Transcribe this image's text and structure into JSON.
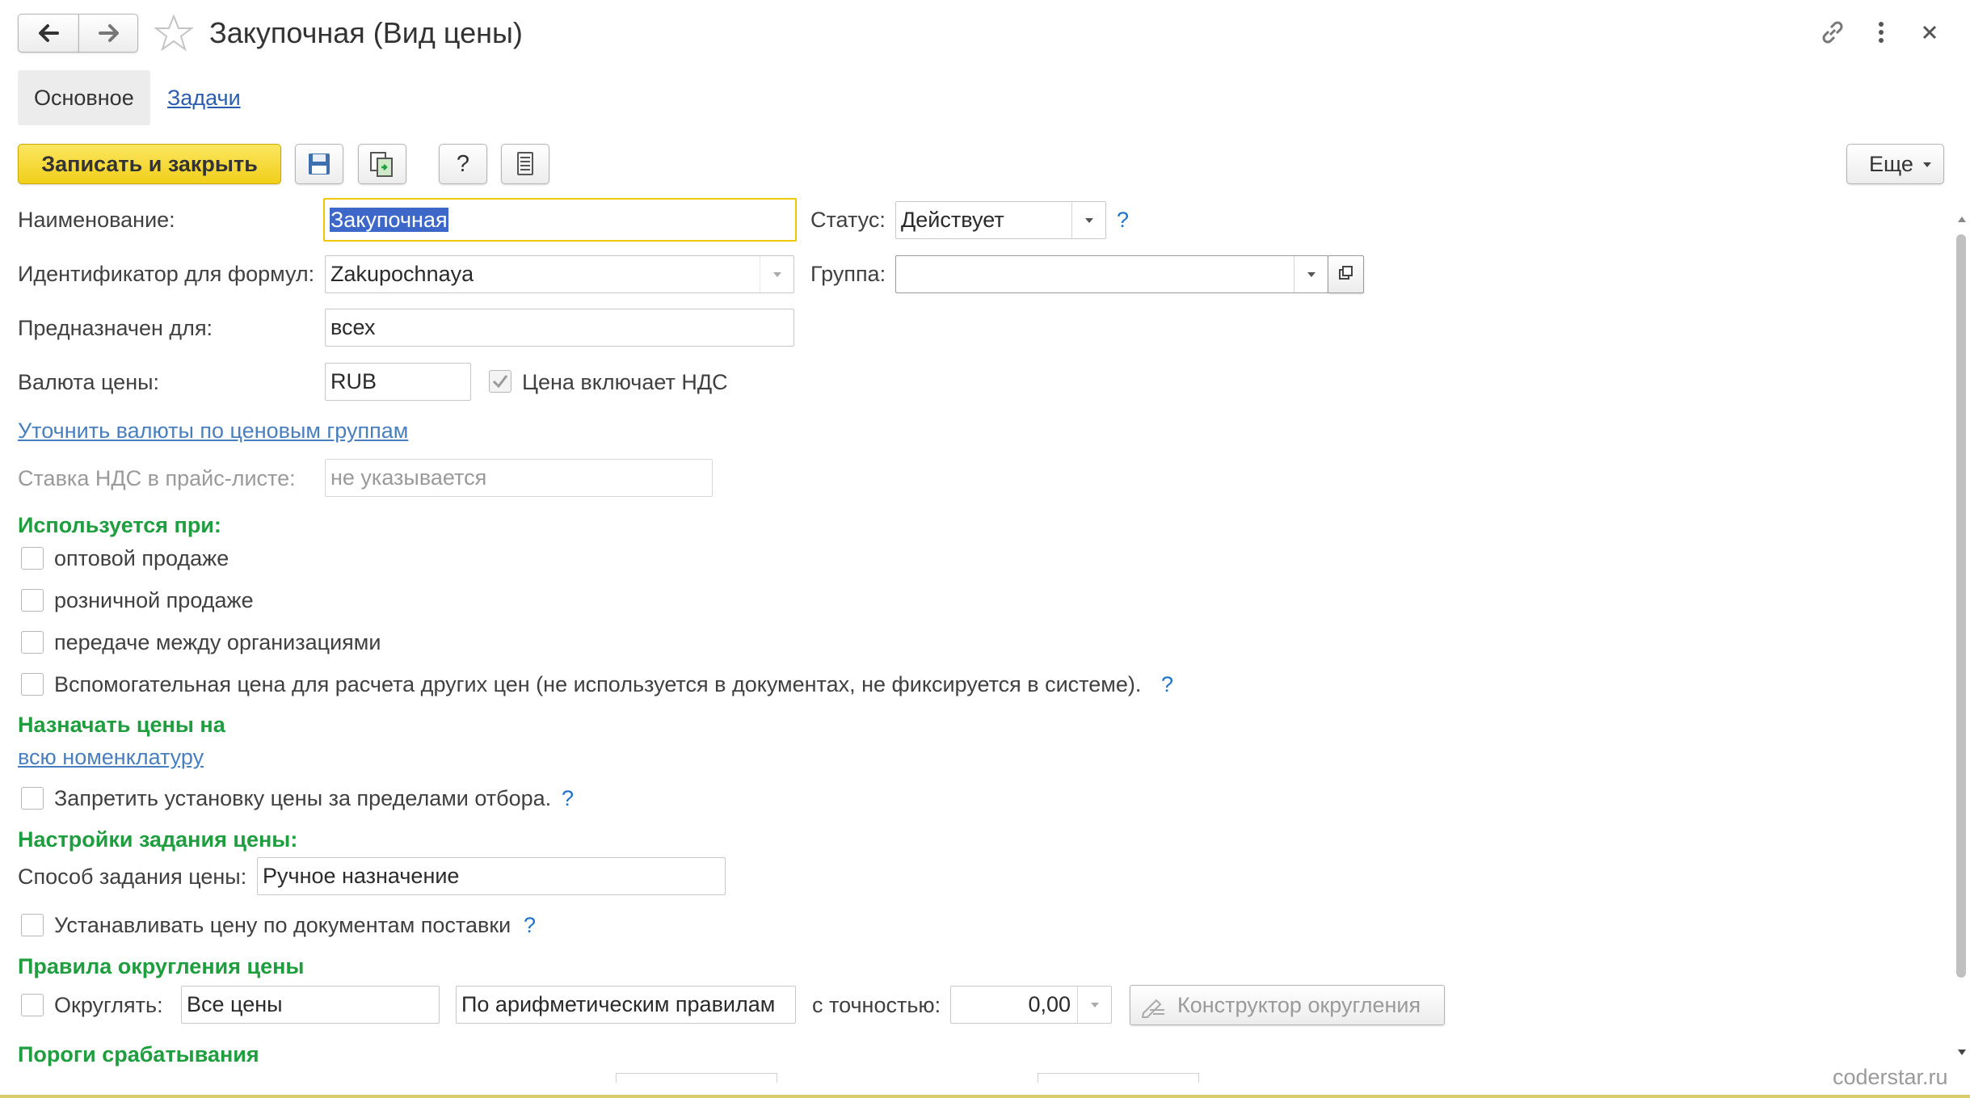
{
  "window": {
    "title": "Закупочная (Вид цены)"
  },
  "tabs": [
    {
      "label": "Основное"
    },
    {
      "label": "Задачи"
    }
  ],
  "toolbar": {
    "save_close_label": "Записать и закрыть",
    "help_label": "?",
    "more_label": "Еще"
  },
  "form": {
    "name_label": "Наименование:",
    "name_value": "Закупочная",
    "status_label": "Статус:",
    "status_value": "Действует",
    "status_help": "?",
    "id_label": "Идентификатор для формул:",
    "id_value": "Zakupochnaya",
    "group_label": "Группа:",
    "group_value": "",
    "intended_label": "Предназначен для:",
    "intended_value": "всех",
    "currency_label": "Валюта цены:",
    "currency_value": "RUB",
    "vat_included_label": "Цена включает НДС",
    "vat_included_checked": true,
    "refine_currency_link": "Уточнить валюты по ценовым группам",
    "vat_rate_label": "Ставка НДС в прайс-листе:",
    "vat_rate_value": "не указывается"
  },
  "used_in": {
    "heading": "Используется при:",
    "items": [
      {
        "label": "оптовой продаже",
        "checked": false
      },
      {
        "label": "розничной продаже",
        "checked": false
      },
      {
        "label": "передаче между организациями",
        "checked": false
      },
      {
        "label": "Вспомогательная цена для расчета других цен (не используется в документах, не фиксируется в системе).",
        "checked": false
      }
    ],
    "help": "?"
  },
  "assign": {
    "heading": "Назначать цены на",
    "link": "всю номенклатуру",
    "forbid_label": "Запретить установку цены за пределами отбора.",
    "forbid_help": "?"
  },
  "price_settings": {
    "heading": "Настройки задания цены:",
    "method_label": "Способ задания цены:",
    "method_value": "Ручное назначение",
    "set_by_docs_label": "Устанавливать цену по документам поставки",
    "set_by_docs_help": "?"
  },
  "rounding": {
    "heading": "Правила округления цены",
    "round_label": "Округлять:",
    "scope_value": "Все цены",
    "rule_value": "По арифметическим правилам",
    "precision_label": "с точностью:",
    "precision_value": "0,00",
    "constructor_label": "Конструктор округления"
  },
  "thresholds": {
    "heading": "Пороги срабатывания"
  },
  "watermark": "coderstar.ru",
  "colors": {
    "accent_yellow": "#f5d92c",
    "section_green": "#1e9e3e",
    "link_blue": "#4a7fbf"
  }
}
